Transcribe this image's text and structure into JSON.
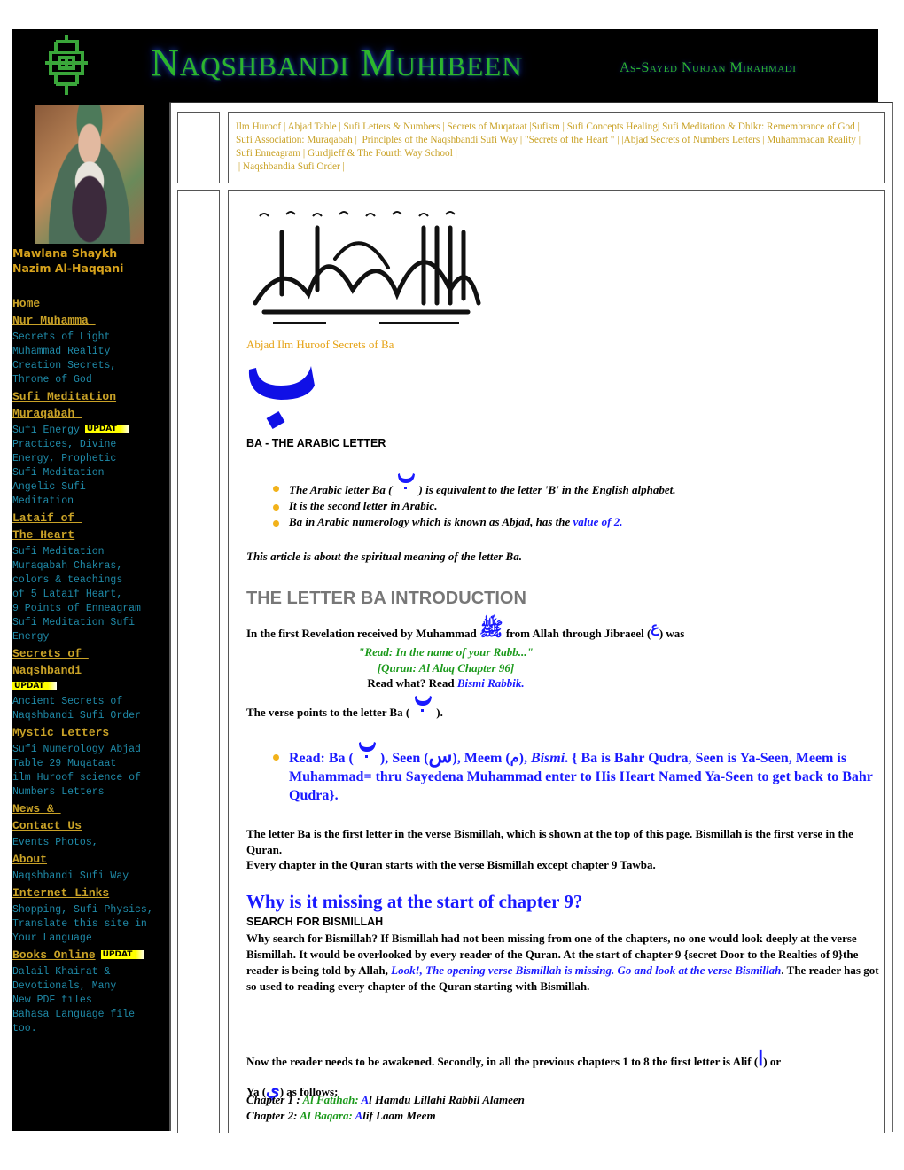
{
  "header": {
    "title": "Naqshbandi Muhibeen",
    "subtitle": "As-Sayed Nurjan Mirahmadi",
    "logo_icon": "knot-calligraphy-logo-icon"
  },
  "sidebar": {
    "portrait_alt": "Mawlana Shaykh Nazim portrait",
    "name_line1": "Mawlana Shaykh",
    "name_line2": "Nazim Al-Haqqani",
    "badge_label": "UPDAT",
    "nav": [
      {
        "label": "Home",
        "subs": []
      },
      {
        "label": "Nur Muhamma ",
        "subs": [
          "Secrets of Light",
          "Muhammad Reality",
          "Creation Secrets,",
          "Throne of God"
        ]
      },
      {
        "label": "Sufi Meditation",
        "subs": []
      },
      {
        "label": "Muraqabah ",
        "subs": [
          "Sufi Energy",
          "Practices, Divine",
          "Energy, Prophetic",
          "Sufi Meditation",
          "Angelic Sufi",
          "Meditation"
        ]
      },
      {
        "label": "Lataif of ",
        "subs": []
      },
      {
        "label": "The Heart",
        "subs": [
          "Sufi Meditation",
          "Muraqabah Chakras,",
          "colors & teachings",
          "of 5 Lataif Heart,",
          "9 Points of Enneagram",
          "Sufi Meditation Sufi",
          "Energy"
        ]
      },
      {
        "label": "Secrets of ",
        "subs": []
      },
      {
        "label": "Naqshbandi",
        "subs": [
          "Ancient Secrets of",
          "Naqshbandi Sufi Order"
        ]
      },
      {
        "label": "Mystic Letters ",
        "subs": [
          "Sufi Numerology Abjad",
          "Table 29 Muqataat",
          "ilm Huroof science of",
          "Numbers Letters"
        ]
      },
      {
        "label": "News & ",
        "subs": []
      },
      {
        "label": "Contact Us",
        "subs": [
          "Events Photos,"
        ]
      },
      {
        "label": "About",
        "subs": [
          "Naqshbandi Sufi Way"
        ]
      },
      {
        "label": "Internet Links",
        "subs": [
          "Shopping, Sufi Physics,",
          "Translate this site in",
          "Your Language"
        ]
      },
      {
        "label": "Books Online",
        "subs": [
          "Dalail Khairat &",
          "Devotionals, Many",
          "New PDF files",
          "Bahasa Language file",
          "too."
        ]
      }
    ]
  },
  "top_links": [
    "Ilm Huroof",
    "Abjad Table",
    "Sufi Letters & Numbers",
    "Secrets of Muqataat",
    "Sufism",
    "Sufi Concepts Healing",
    "Sufi Meditation & Dhikr: Remembrance of God",
    "Sufi Association: Muraqabah",
    "Principles of the Naqshbandi Sufi Way",
    "\"Secrets of the Heart \"",
    "Abjad Secrets of Numbers Letters",
    "Muhammadan Reality",
    "Sufi Enneagram",
    "Gurdjieff & The Fourth Way School",
    "Naqshbandia Sufi Order"
  ],
  "content": {
    "bismillah_alt": "Bismillah calligraphy",
    "abjad_caption": "Abjad Ilm Huroof Secrets of Ba",
    "ba_glyph": "ب",
    "ba_heading": "BA - THE ARABIC LETTER",
    "facts": {
      "f1_before": "The Arabic letter Ba (",
      "f1_after": ") is equivalent to the letter 'B' in the English alphabet.",
      "f2": "It is the second letter in Arabic.",
      "f3_before": "Ba in Arabic numerology which is known as Abjad, has the ",
      "f3_link": "value of 2."
    },
    "article_about": "This article is about the spiritual meaning of the letter Ba.",
    "intro_heading": "THE LETTER BA INTRODUCTION",
    "intro": {
      "p_before": "In the first Revelation received by Muhammad ",
      "p_mid": " from Allah through Jibraeel (",
      "p_after": ") was",
      "quote": "\"Read: In the name of your Rabb...\"",
      "citation": "[Quran: Al Alaq Chapter 96]",
      "read_what": "Read what? Read ",
      "bismi_rabbik": "Bismi Rabbik.",
      "salawat_glyph": "ﷺ",
      "ain_glyph": "ع"
    },
    "verse_points_before": "The verse points to the letter Ba (",
    "verse_points_after": ").",
    "read": {
      "t1": "Read: Ba (",
      "t2": "), Seen (",
      "t3": "), Meem (",
      "t4": "), ",
      "bismi": "Bismi",
      "t5": ". { Ba is Bahr Qudra, Seen is Ya-Seen, Meem is Muhammad= thru Sayedena Muhammad enter to His Heart Named Ya-Seen to get back to Bahr Qudra}.",
      "seen_glyph": "س",
      "meem_glyph": "م"
    },
    "first_letter_p1": "The letter Ba is the first letter in the verse Bismillah, which is shown at the top of this page. Bismillah is the first verse in the Quran.",
    "first_letter_p2": "Every chapter in the Quran starts with the verse Bismillah except chapter 9 Tawba.",
    "why_heading": "Why is it missing at the start of chapter 9?",
    "search_heading": "SEARCH FOR BISMILLAH",
    "why_p_before": "Why search for Bismillah? If Bismillah had not been missing from one of the chapters, no one would look deeply at the verse Bismillah. It would be overlooked by every reader of the Quran. At the start of chapter 9 {secret Door to the Realties of 9}the reader is being told by Allah, ",
    "why_p_link": "Look!, The opening verse Bismillah is missing. Go and look at the verse Bismillah",
    "why_p_after": ". The reader has got so used to reading every chapter of the Quran starting with Bismillah.",
    "awaken_before": "Now the reader needs to be awakened. Secondly, in all the previous chapters 1 to 8 the first letter is Alif (",
    "awaken_mid": ") or",
    "awaken_ya": "Ya (",
    "awaken_after": ") as follows:",
    "alif_glyph": "ا",
    "ya_glyph": "ي",
    "chapters": [
      {
        "label": "Chapter 1 : ",
        "name": "Al Fatihah: ",
        "first": "A",
        "rest": "l Hamdu Lillahi Rabbil Alameen"
      },
      {
        "label": "Chapter 2: ",
        "name": "Al Baqara: ",
        "first": "A",
        "rest": "lif Laam Meem"
      }
    ]
  }
}
